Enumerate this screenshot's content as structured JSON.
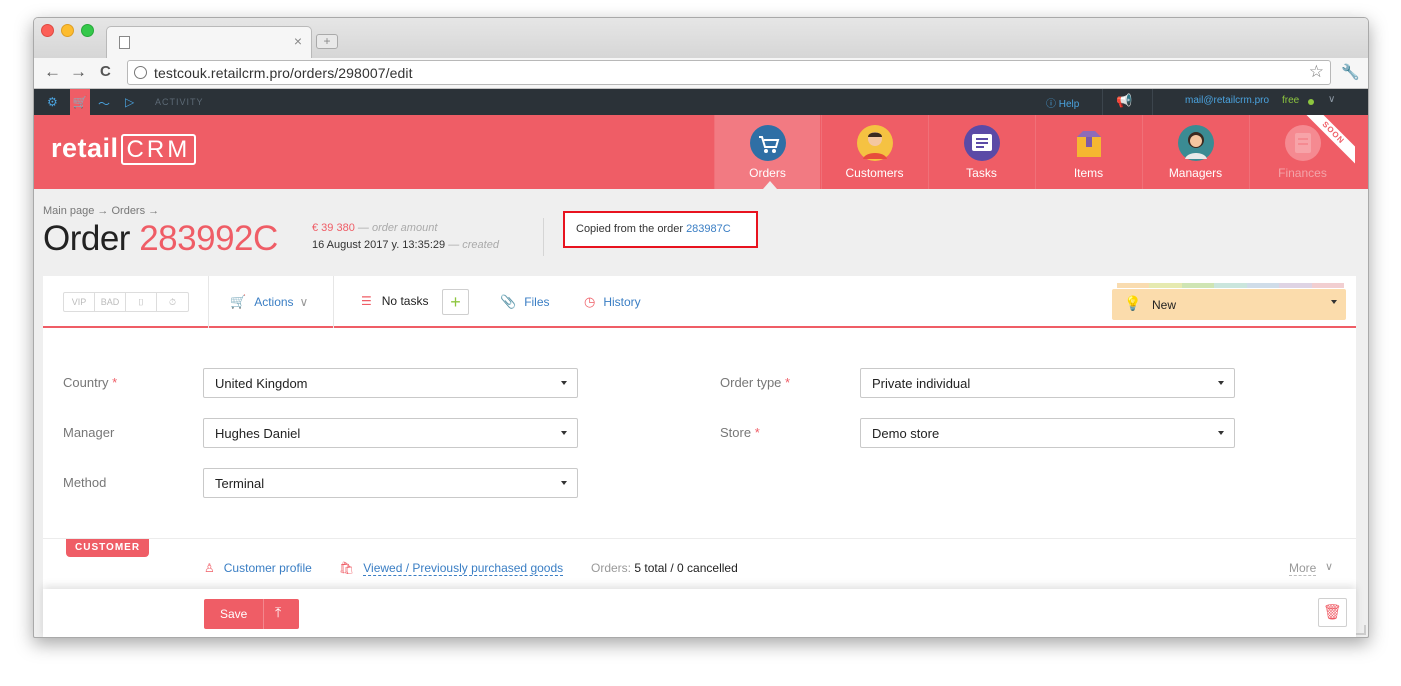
{
  "browser": {
    "tab_close": "×",
    "newtab_symbol": "+",
    "back": "←",
    "forward": "→",
    "reload": "C",
    "url": "testcouk.retailcrm.pro/orders/298007/edit",
    "star": "☆",
    "wrench": "🔧"
  },
  "crm_bar": {
    "settings_icon": "⚙",
    "cart_icon": "🛒",
    "analytics_icon": "〜",
    "play_icon": "▷",
    "activity": "ACTIVITY",
    "help": "ⓘ Help",
    "megaphone": "📢",
    "email": "mail@retailcrm.pro",
    "plan": "free",
    "chevron": "∨"
  },
  "header": {
    "logo_text": "retail",
    "logo_crm": "CRM",
    "modules": [
      {
        "label": "Orders",
        "icon": "cart-icon",
        "active": true
      },
      {
        "label": "Customers",
        "icon": "person-icon"
      },
      {
        "label": "Tasks",
        "icon": "list-icon"
      },
      {
        "label": "Items",
        "icon": "box-icon"
      },
      {
        "label": "Managers",
        "icon": "manager-icon"
      },
      {
        "label": "Finances",
        "icon": "finances-icon",
        "disabled": true,
        "badge": "SOON"
      }
    ]
  },
  "page": {
    "breadcrumb": "Main page → Orders →",
    "order_label": "Order",
    "order_number": "283992C",
    "amount": "€ 39 380",
    "amount_note": "— order amount",
    "created": "16 August 2017 y. 13:35:29",
    "created_note": "— created",
    "copied_text": "Copied from the order",
    "copied_link": "283987C"
  },
  "actionbar": {
    "flags": [
      "VIP",
      "BAD",
      "⌷",
      "⏱"
    ],
    "actions": "Actions",
    "no_tasks": "No tasks",
    "add_task": "+",
    "files": "Files",
    "history": "History",
    "status": "New",
    "status_strip_colors": [
      "#f9dcb0",
      "#e6eab0",
      "#cfe5b4",
      "#cbe6dd",
      "#d0dde9",
      "#dfd4e4",
      "#f2cfd1"
    ]
  },
  "form": {
    "country_label": "Country",
    "country_value": "United Kingdom",
    "manager_label": "Manager",
    "manager_value": "Hughes Daniel",
    "method_label": "Method",
    "method_value": "Terminal",
    "order_type_label": "Order type",
    "order_type_value": "Private individual",
    "store_label": "Store",
    "store_value": "Demo store",
    "required_mark": "*"
  },
  "customer": {
    "badge": "CUSTOMER",
    "profile": "Customer profile",
    "viewed": "Viewed / Previously purchased goods",
    "orders_label": "Orders:",
    "orders_value": "5 total / 0 cancelled",
    "more": "More"
  },
  "footer": {
    "save": "Save",
    "up_arrow": "⤒",
    "trash": "🗑"
  },
  "colors": {
    "brand": "#ef5d66",
    "link": "#3a7ec4",
    "status_bg": "#fbdcac",
    "highlight_border": "#e8131f"
  }
}
